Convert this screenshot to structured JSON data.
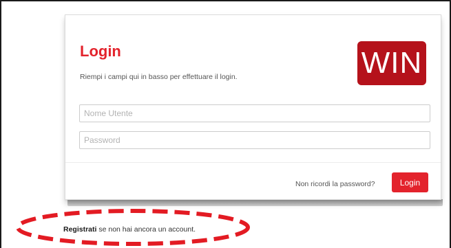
{
  "login": {
    "title": "Login",
    "subtitle": "Riempi i campi qui in basso per effettuare il login.",
    "logo_text": "WIN",
    "username_placeholder": "Nome Utente",
    "password_placeholder": "Password",
    "forgot_label": "Non ricordi la password?",
    "button_label": "Login"
  },
  "register": {
    "link_label": "Registrati",
    "text": " se non hai ancora un account."
  },
  "colors": {
    "accent": "#e3232c",
    "logo_bg": "#b5121b",
    "annotation": "#e31b23"
  },
  "icons": {
    "annotation": "dashed-highlight-ellipse"
  }
}
